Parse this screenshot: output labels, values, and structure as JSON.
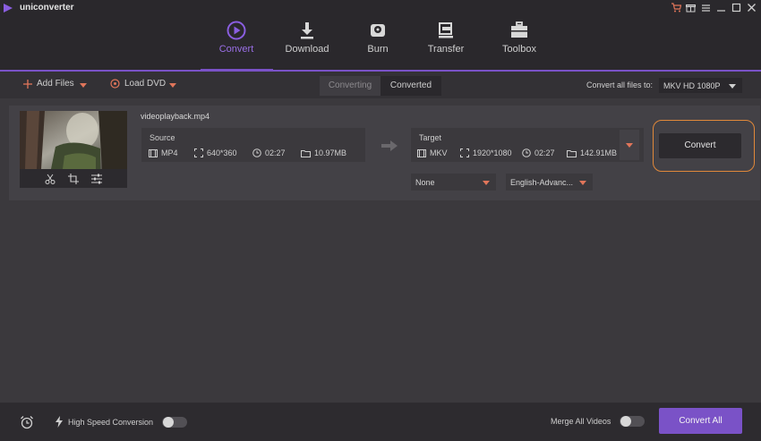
{
  "app": {
    "title": "uniconverter",
    "colors": {
      "accent": "#7a52c7",
      "highlight": "#e0883a",
      "caret": "#e0755a"
    },
    "window_controls": [
      "cart-icon",
      "gift-icon",
      "menu-icon",
      "minimize-icon",
      "maximize-icon",
      "close-icon"
    ]
  },
  "nav": {
    "items": [
      {
        "label": "Convert",
        "icon": "convert-icon",
        "active": true
      },
      {
        "label": "Download",
        "icon": "download-icon",
        "active": false
      },
      {
        "label": "Burn",
        "icon": "burn-icon",
        "active": false
      },
      {
        "label": "Transfer",
        "icon": "transfer-icon",
        "active": false
      },
      {
        "label": "Toolbox",
        "icon": "toolbox-icon",
        "active": false
      }
    ]
  },
  "toolbar": {
    "add_files": "Add Files",
    "load_dvd": "Load DVD",
    "tabs": [
      {
        "label": "Converting",
        "active": true
      },
      {
        "label": "Converted",
        "active": false
      }
    ],
    "convert_all_to_label": "Convert all files to:",
    "convert_all_to_value": "MKV HD 1080P"
  },
  "file": {
    "name": "videoplayback.mp4",
    "source": {
      "title": "Source",
      "format": "MP4",
      "resolution": "640*360",
      "duration": "02:27",
      "size": "10.97MB"
    },
    "target": {
      "title": "Target",
      "format": "MKV",
      "resolution": "1920*1080",
      "duration": "02:27",
      "size": "142.91MB"
    },
    "subtitle_select": "None",
    "audio_select": "English-Advanc...",
    "convert_button": "Convert",
    "thumb_tools": [
      "scissors-icon",
      "crop-icon",
      "settings-sliders-icon"
    ]
  },
  "bottom": {
    "high_speed_label": "High Speed Conversion",
    "high_speed_on": false,
    "merge_label": "Merge All Videos",
    "merge_on": false,
    "convert_all": "Convert All"
  }
}
